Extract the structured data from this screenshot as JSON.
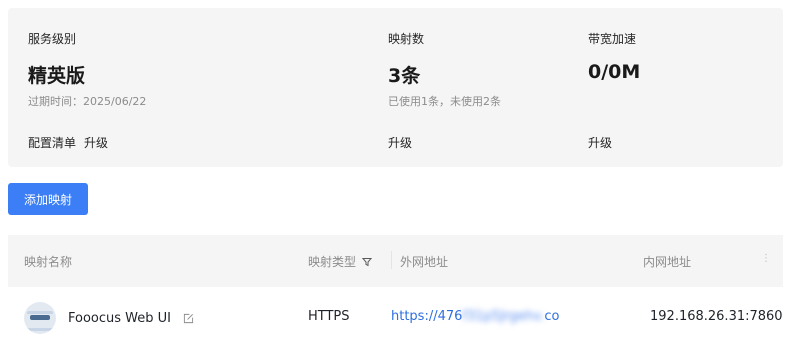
{
  "summary": {
    "service": {
      "label": "服务级别",
      "value": "精英版",
      "sub": "过期时间：2025/06/22",
      "footer_label": "配置清单",
      "footer_link": "升级"
    },
    "mappings": {
      "label": "映射数",
      "value": "3条",
      "sub": "已使用1条，未使用2条",
      "footer_link": "升级"
    },
    "bandwidth": {
      "label": "带宽加速",
      "value": "0/0M",
      "footer_link": "升级"
    }
  },
  "add_button": "添加映射",
  "table": {
    "headers": {
      "name": "映射名称",
      "type": "映射类型",
      "external": "外网地址",
      "internal": "内网地址",
      "more": "⋮"
    },
    "rows": [
      {
        "name": "Fooocus Web UI",
        "type": "HTTPS",
        "external_prefix": "https://476",
        "external_hidden": "f31p5Jrgehv.",
        "external_suffix": "co",
        "internal": "192.168.26.31:7860"
      }
    ]
  },
  "icons": {
    "filter": "filter-icon",
    "edit": "edit-icon",
    "app": "fooocus-app-icon"
  },
  "colors": {
    "primary": "#3b7ef6",
    "link": "#2f6fe0",
    "panel_bg": "#f5f5f5"
  }
}
